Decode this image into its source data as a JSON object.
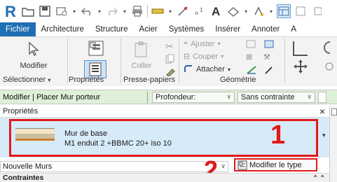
{
  "app_title_bar": {
    "logo": "revit-R-logo",
    "qat_icons": [
      "open-folder-icon",
      "save-icon",
      "sync-icon",
      "undo-icon",
      "redo-icon",
      "print-icon",
      "measure-icon",
      "dimension-icon",
      "tag-icon",
      "text-A-icon",
      "3d-view-icon",
      "section-icon",
      "switch-windows-icon",
      "thin-lines-icon"
    ]
  },
  "menubar": {
    "tabs": [
      "Fichier",
      "Architecture",
      "Structure",
      "Acier",
      "Systèmes",
      "Insérer",
      "Annoter",
      "A"
    ],
    "active_tab": "Fichier"
  },
  "ribbon": {
    "modify_label": "Modifier",
    "paste_label": "Coller",
    "cut_label": "Ajuster",
    "copy_label": "Couper",
    "join_label": "Attacher",
    "groups": {
      "select": "Sélectionner",
      "properties": "Propriétés",
      "clipboard": "Presse-papiers",
      "geometry": "Géométrie"
    }
  },
  "options_bar": {
    "context": "Modifier | Placer Mur porteur",
    "depth_value": "Profondeur:",
    "constraint_value": "Sans contrainte"
  },
  "properties_panel": {
    "title": "Propriétés",
    "close": "×",
    "type_name": "Mur de base",
    "type_subname": "M1 enduit 2 +BBMC 20+  iso 10",
    "marker_1": "1",
    "marker_2": "2",
    "family_selector": "Nouvelle Murs",
    "edit_type_label": "Modifier le type",
    "section_constraints": "Contraintes"
  },
  "colors": {
    "accent_blue": "#1e6fb4",
    "highlight_red": "#e31919",
    "type_selector_bg": "#d7eaf8",
    "options_bar_bg": "#dff0d8"
  }
}
